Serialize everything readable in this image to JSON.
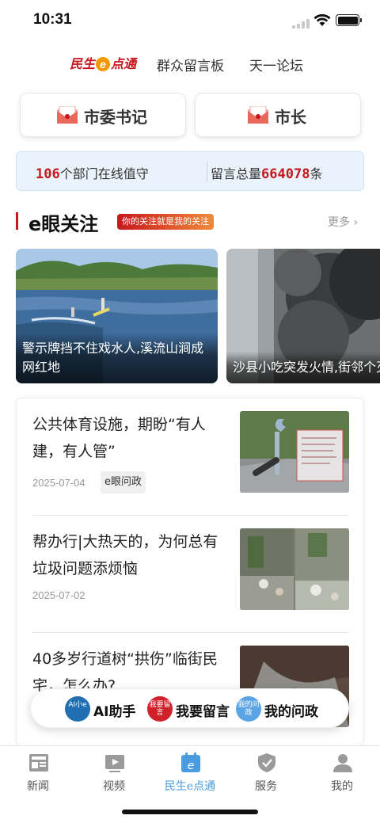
{
  "status": {
    "time": "10:31"
  },
  "topnav": {
    "brand_a": "民生",
    "brand_e": "e",
    "brand_b": "点通",
    "links": [
      "群众留言板",
      "天一论坛"
    ]
  },
  "leaders": [
    {
      "label": "市委书记"
    },
    {
      "label": "市长"
    }
  ],
  "stats": {
    "departments_count": "106",
    "departments_suffix": "个部门在线值守",
    "total_prefix": "留言总量",
    "total_count": "664078",
    "total_suffix": "条"
  },
  "section": {
    "title": "e眼关注",
    "tag": "你的关注就是我的关注",
    "more": "更多"
  },
  "cards": [
    {
      "caption": "警示牌挡不住戏水人,溪流山涧成网红地"
    },
    {
      "caption": "沙县小吃突发火情,街邻个灭火器"
    }
  ],
  "news": [
    {
      "title": "公共体育设施，期盼“有人建，有人管”",
      "date": "2025-07-04",
      "tag": "e眼问政"
    },
    {
      "title": "帮办行|大热天的，为何总有垃圾问题添烦恼",
      "date": "2025-07-02",
      "tag": ""
    },
    {
      "title": "40多岁行道树“拱伤”临街民宅，怎么办?",
      "date": "",
      "tag": ""
    }
  ],
  "pill": {
    "ai_icon": "AI小e",
    "ai_label": "AI助手",
    "msg_icon": "我要留言",
    "msg_label": "我要留言",
    "mine_icon": "我的问政",
    "mine_label": "我的问政"
  },
  "tabs": [
    {
      "label": "新闻",
      "icon": "news-icon"
    },
    {
      "label": "视频",
      "icon": "video-icon"
    },
    {
      "label": "民生e点通",
      "icon": "e-service-icon",
      "active": true
    },
    {
      "label": "服务",
      "icon": "service-icon"
    },
    {
      "label": "我的",
      "icon": "profile-icon"
    }
  ],
  "colors": {
    "accent": "#c8161d",
    "tab_active": "#4a9be0",
    "stats_bg": "#eaf2fb"
  }
}
